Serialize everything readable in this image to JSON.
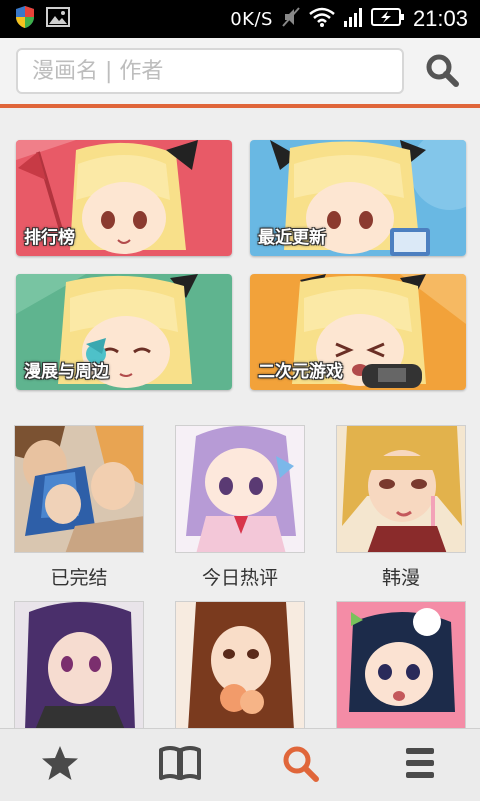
{
  "status_bar": {
    "network_speed": "0K/S",
    "clock": "21:03"
  },
  "search": {
    "placeholder": "漫画名 | 作者"
  },
  "categories": [
    {
      "label": "排行榜",
      "color": "#e85a67"
    },
    {
      "label": "最近更新",
      "color": "#69b8e3"
    },
    {
      "label": "漫展与周边",
      "color": "#5fb48f"
    },
    {
      "label": "二次元游戏",
      "color": "#f2a23a"
    }
  ],
  "comics": [
    {
      "title": "已完结"
    },
    {
      "title": "今日热评"
    },
    {
      "title": "韩漫"
    },
    {
      "title": ""
    },
    {
      "title": ""
    },
    {
      "title": ""
    }
  ],
  "bottom_nav": {
    "items": [
      "star-icon",
      "book-icon",
      "search-icon",
      "menu-icon"
    ],
    "active": "search-icon",
    "active_color": "#e0663a",
    "inactive_color": "#4a4a4a"
  }
}
